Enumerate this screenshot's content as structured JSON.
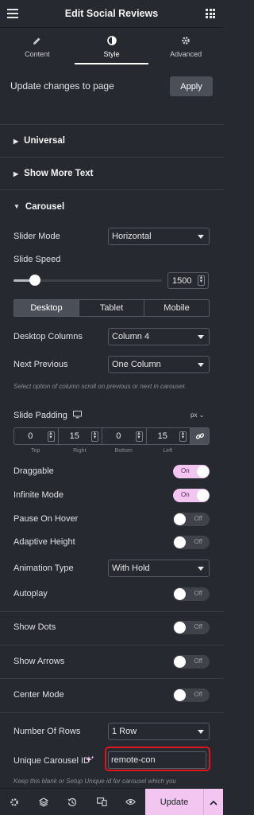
{
  "header": {
    "title": "Edit Social Reviews",
    "menu_icon": "hamburger-icon",
    "apps_icon": "grid-icon"
  },
  "tabs": [
    {
      "label": "Content",
      "icon": "pencil-icon"
    },
    {
      "label": "Style",
      "icon": "contrast-icon",
      "active": true
    },
    {
      "label": "Advanced",
      "icon": "gear-icon"
    }
  ],
  "update_bar": {
    "text": "Update changes to page",
    "apply_label": "Apply"
  },
  "sections": {
    "universal": "Universal",
    "show_more": "Show More Text",
    "carousel": "Carousel"
  },
  "fields": {
    "slider_mode": {
      "label": "Slider Mode",
      "value": "Horizontal"
    },
    "slide_speed": {
      "label": "Slide Speed",
      "value": "1500",
      "fraction": 0.13
    },
    "devices": [
      "Desktop",
      "Tablet",
      "Mobile"
    ],
    "desktop_columns": {
      "label": "Desktop Columns",
      "value": "Column 4"
    },
    "next_previous": {
      "label": "Next Previous",
      "value": "One Column",
      "hint": "Select option of column scroll on previous or next in carousel."
    },
    "slide_padding": {
      "label": "Slide Padding",
      "unit": "px",
      "values": [
        "0",
        "15",
        "0",
        "15"
      ],
      "sides": [
        "Top",
        "Right",
        "Bottom",
        "Left"
      ]
    },
    "draggable": {
      "label": "Draggable",
      "state": "On"
    },
    "infinite_mode": {
      "label": "Infinite Mode",
      "state": "On"
    },
    "pause_on_hover": {
      "label": "Pause On Hover",
      "state": "Off"
    },
    "adaptive_height": {
      "label": "Adaptive Height",
      "state": "Off"
    },
    "animation_type": {
      "label": "Animation Type",
      "value": "With Hold"
    },
    "autoplay": {
      "label": "Autoplay",
      "state": "Off"
    },
    "show_dots": {
      "label": "Show Dots",
      "state": "Off"
    },
    "show_arrows": {
      "label": "Show Arrows",
      "state": "Off"
    },
    "center_mode": {
      "label": "Center Mode",
      "state": "Off"
    },
    "number_of_rows": {
      "label": "Number Of Rows",
      "value": "1 Row"
    },
    "unique_id": {
      "label": "Unique Carousel ID",
      "value": "remote-con",
      "hint": "Keep this blank or Setup Unique id for carousel which you"
    }
  },
  "footer": {
    "update_label": "Update"
  },
  "colors": {
    "accent_pink": "#f2c6f0",
    "panel_bg": "#26292f",
    "highlight_red": "#e0141c"
  }
}
